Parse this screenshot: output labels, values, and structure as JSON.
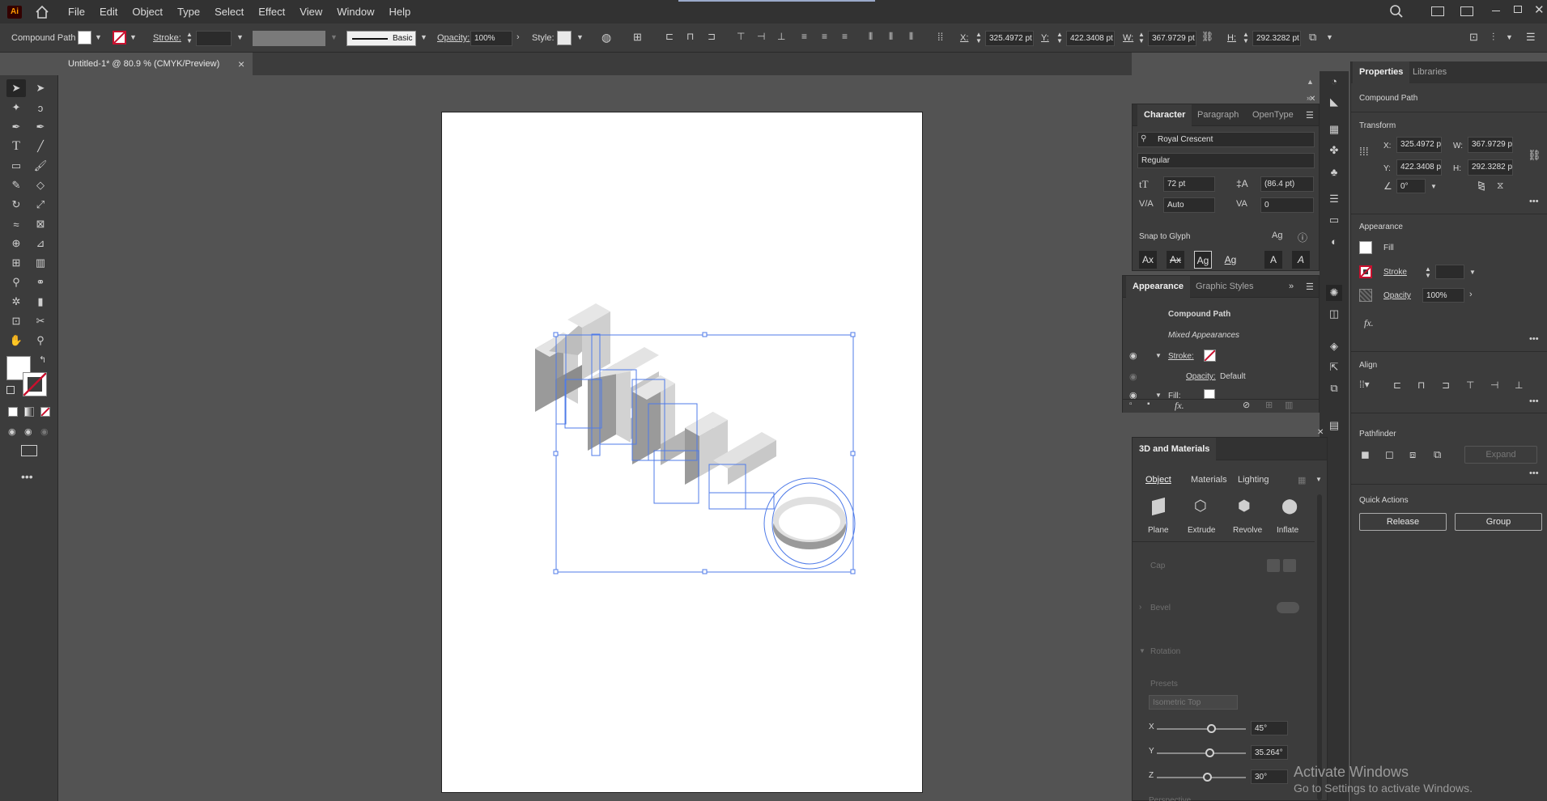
{
  "app": {
    "logo_text": "Ai"
  },
  "menu": [
    "File",
    "Edit",
    "Object",
    "Type",
    "Select",
    "Effect",
    "View",
    "Window",
    "Help"
  ],
  "control_bar": {
    "object_type": "Compound Path",
    "stroke_label": "Stroke:",
    "stroke_style": "Basic",
    "opacity_label": "Opacity:",
    "opacity_value": "100%",
    "style_label": "Style:",
    "x_label": "X:",
    "x_value": "325.4972 pt",
    "y_label": "Y:",
    "y_value": "422.3408 pt",
    "w_label": "W:",
    "w_value": "367.9729 pt",
    "h_label": "H:",
    "h_value": "292.3282 pt"
  },
  "document_tab": {
    "title": "Untitled-1* @ 80.9 % (CMYK/Preview)",
    "close": "×"
  },
  "character_panel": {
    "tabs": [
      "Character",
      "Paragraph",
      "OpenType"
    ],
    "font_family": "Royal Crescent",
    "font_style": "Regular",
    "font_size": "72 pt",
    "leading": "(86.4 pt)",
    "kerning": "Auto",
    "tracking": "0",
    "snap_label": "Snap to Glyph",
    "snap_glyphs": [
      "Ax",
      "Ax",
      "Ag",
      "Ag",
      "A",
      "A"
    ]
  },
  "appearance_panel": {
    "tabs": [
      "Appearance",
      "Graphic Styles"
    ],
    "title": "Compound Path",
    "mixed": "Mixed Appearances",
    "stroke_label": "Stroke:",
    "opacity_label": "Opacity:",
    "opacity_value": "Default",
    "fill_label": "Fill:",
    "fx": "fx."
  },
  "materials_panel": {
    "title": "3D and Materials",
    "tabs": [
      "Object",
      "Materials",
      "Lighting"
    ],
    "types": [
      "Plane",
      "Extrude",
      "Revolve",
      "Inflate"
    ],
    "cap_label": "Cap",
    "bevel_label": "Bevel",
    "rotation_label": "Rotation",
    "presets_label": "Presets",
    "preset_value": "Isometric Top",
    "x_label": "X",
    "x_value": "45°",
    "y_label": "Y",
    "y_value": "35.264°",
    "z_label": "Z",
    "z_value": "30°",
    "rot_x_level": 0.62,
    "rot_y_level": 0.6,
    "rot_z_level": 0.57,
    "perspective_label": "Perspective"
  },
  "properties_panel": {
    "tabs": [
      "Properties",
      "Libraries"
    ],
    "object_type": "Compound Path",
    "transform_label": "Transform",
    "x_label": "X:",
    "x_value": "325.4972 p",
    "y_label": "Y:",
    "y_value": "422.3408 p",
    "w_label": "W:",
    "w_value": "367.9729 p",
    "h_label": "H:",
    "h_value": "292.3282 p",
    "angle_value": "0°",
    "appearance_label": "Appearance",
    "fill_label": "Fill",
    "stroke_label": "Stroke",
    "opacity_label": "Opacity",
    "opacity_value": "100%",
    "fx": "fx.",
    "align_label": "Align",
    "pathfinder_label": "Pathfinder",
    "expand_label": "Expand",
    "quick_actions_label": "Quick Actions",
    "release_label": "Release",
    "group_label": "Group"
  },
  "watermark": {
    "line1": "Activate Windows",
    "line2": "Go to Settings to activate Windows."
  }
}
